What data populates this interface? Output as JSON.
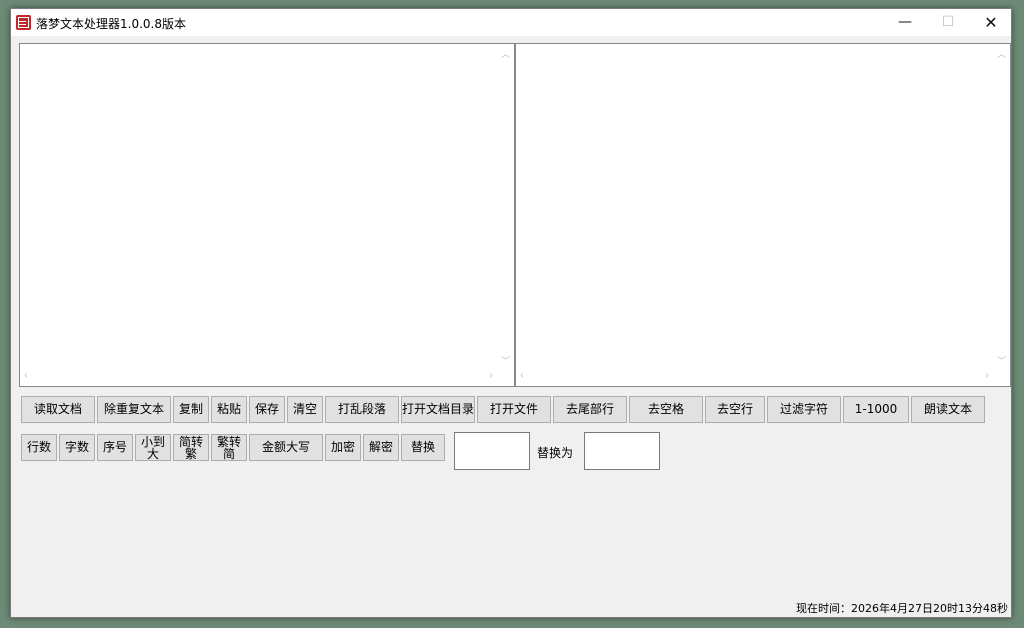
{
  "window": {
    "title": "落梦文本处理器1.0.0.8版本",
    "controls": {
      "minimize": "—",
      "maximize": "☐",
      "close": "✕"
    }
  },
  "row1_buttons": [
    "读取文档",
    "除重复文本",
    "复制",
    "粘贴",
    "保存",
    "清空",
    "打乱段落",
    "打开文档目录",
    "打开文件",
    "去尾部行",
    "去空格",
    "去空行",
    "过滤字符",
    "1-1000",
    "朗读文本"
  ],
  "row2_buttons": [
    "行数",
    "字数",
    "序号",
    "小到\n大",
    "简转\n繁",
    "繁转\n简",
    "金额大写",
    "加密",
    "解密",
    "替换"
  ],
  "replace": {
    "label": "替换为",
    "find_value": "",
    "replace_value": ""
  },
  "status": {
    "time_text": "现在时间：2026年4月27日20时13分48秒"
  },
  "colors": {
    "window_bg": "#f0f0f0",
    "button_bg": "#e1e1e1",
    "button_border": "#adadad",
    "icon_red": "#c0282d"
  }
}
